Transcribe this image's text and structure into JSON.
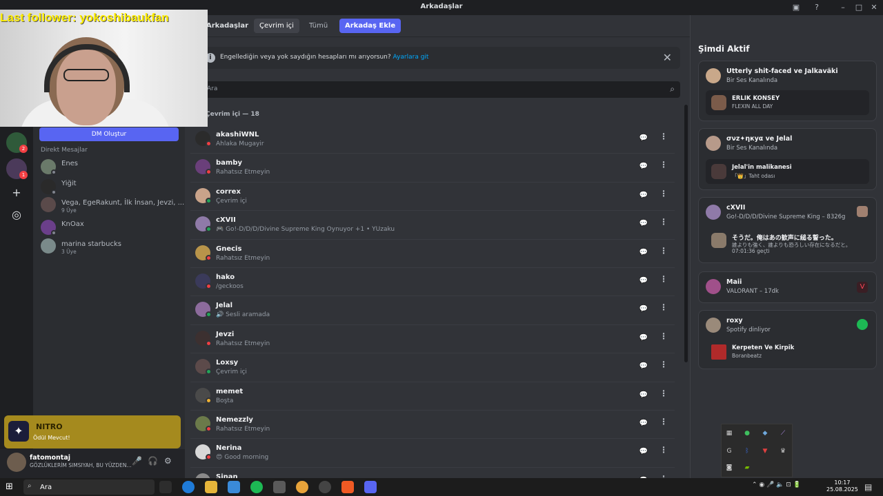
{
  "window": {
    "title": "Arkadaşlar"
  },
  "overlay": {
    "follower_text": "Last follower: yokoshibaukfan"
  },
  "nav": {
    "friends": "Arkadaşlar",
    "online": "Çevrim içi",
    "all": "Tümü",
    "add": "Arkadaş Ekle"
  },
  "banner": {
    "text": "Engellediğin veya yok saydığın hesapları mı arıyorsun?",
    "link": "Ayarlara git"
  },
  "search": {
    "placeholder": "Ara"
  },
  "online_count": "Çevrim içi — 18",
  "dm": {
    "create": "DM Oluştur",
    "header": "Direkt Mesajlar",
    "items": [
      {
        "name": "Enes",
        "sub": ""
      },
      {
        "name": "Yiğit",
        "sub": ""
      },
      {
        "name": "Vega, EgeRakunt, İlk İnsan, Jevzi, ...",
        "sub": "9 Üye"
      },
      {
        "name": "KnOax",
        "sub": ""
      },
      {
        "name": "marina starbucks",
        "sub": "3 Üye"
      }
    ]
  },
  "guild_badges": [
    "2",
    "1"
  ],
  "promo": {
    "title": "NITRO",
    "subtitle": "Ödül Mevcut!"
  },
  "user": {
    "name": "fatomontaj",
    "status": "GÖZLÜKLERİM SIMSIYAH, BU YÜZDEN..."
  },
  "friends": [
    {
      "name": "akashiWNL",
      "status": "Ahlaka Mugayir",
      "color": "#2b2b2b",
      "dot": "#f23f43"
    },
    {
      "name": "bamby",
      "status": "Rahatsız Etmeyin",
      "color": "#6a3f7a",
      "dot": "#f23f43"
    },
    {
      "name": "correx",
      "status": "Çevrim içi",
      "color": "#c9a38a",
      "dot": "#23a559"
    },
    {
      "name": "cXVII",
      "status": "🎮 Go!-D/D/D/Divine Supreme King Oynuyor +1 • YUzaku",
      "color": "#8f7aa8",
      "dot": "#23a559"
    },
    {
      "name": "Gnecis",
      "status": "Rahatsız Etmeyin",
      "color": "#b8944a",
      "dot": "#f23f43"
    },
    {
      "name": "hako",
      "status": "/geckoos",
      "color": "#3a3a5a",
      "dot": "#f23f43"
    },
    {
      "name": "Jelal",
      "status": "🔊 Sesli aramada",
      "color": "#8c6b9c",
      "dot": "#23a559"
    },
    {
      "name": "Jevzi",
      "status": "Rahatsız Etmeyin",
      "color": "#3c3030",
      "dot": "#f23f43"
    },
    {
      "name": "Loxsy",
      "status": "Çevrim içi",
      "color": "#5c4a4a",
      "dot": "#23a559"
    },
    {
      "name": "memet",
      "status": "Boşta",
      "color": "#4a4a4a",
      "dot": "#f0b232"
    },
    {
      "name": "Nemezzly",
      "status": "Rahatsız Etmeyin",
      "color": "#6b7a4a",
      "dot": "#f23f43"
    },
    {
      "name": "Nerina",
      "status": "😍 Good morning",
      "color": "#d8d8d8",
      "dot": "#f23f43"
    },
    {
      "name": "Sinan",
      "status": "",
      "color": "#8a8a8a",
      "dot": "#23a559"
    }
  ],
  "active": {
    "title": "Şimdi Aktif",
    "cards": [
      {
        "title": "Utterly shit-faced ve Jalkaväki",
        "sub": "Bir Ses Kanalında",
        "inner_title": "ERLIK KONSEY",
        "inner_sub": "FLEXIN ALL DAY"
      },
      {
        "title": "σνz✦ηкуα ve Jelal",
        "sub": "Bir Ses Kanalında",
        "inner_title": "Jelal'in malikanesi",
        "inner_sub": "「👑」Taht odası"
      },
      {
        "title": "cXVII",
        "sub": "Go!-D/D/D/Divine Supreme King – 8326g",
        "inner_title": "そうだ。俺はあの歓声に縋る誓った。",
        "inner_sub": "誰よりも強く、誰よりも恐ろしい存在になるだと。",
        "inner_time": "07:01:36 geçti"
      },
      {
        "title": "Maii",
        "sub": "VALORANT – 17dk"
      },
      {
        "title": "roxy",
        "sub": "Spotify dinliyor",
        "inner_title": "Kerpeten Ve Kirpik",
        "inner_sub": "Boranbeatz"
      }
    ]
  },
  "taskbar": {
    "search": "Ara",
    "time": "10:17",
    "date": "25.08.2025"
  },
  "colors": {
    "accent": "#5865f2",
    "online": "#23a559",
    "dnd": "#f23f43",
    "idle": "#f0b232"
  }
}
